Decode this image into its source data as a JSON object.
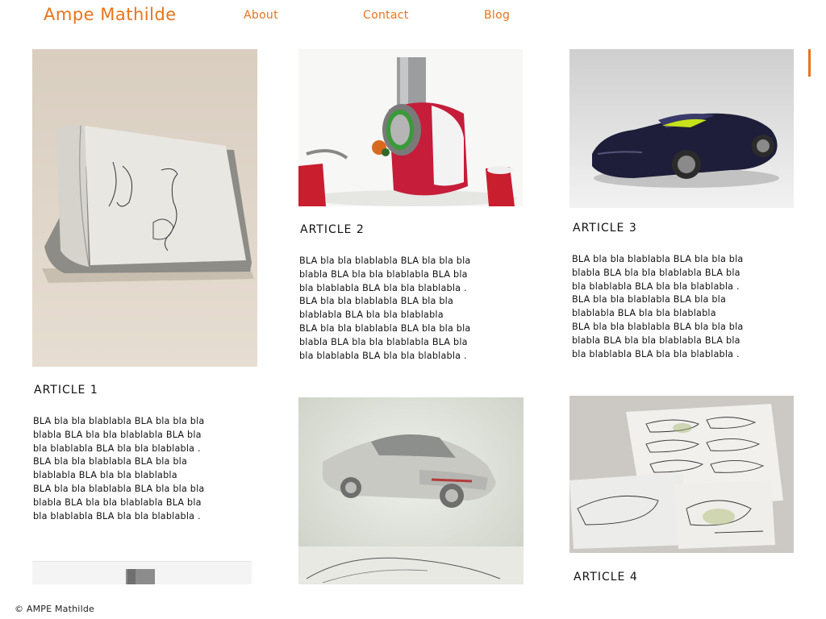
{
  "header": {
    "brand": "Ampe Mathilde",
    "nav": [
      {
        "label": "About"
      },
      {
        "label": "Contact"
      },
      {
        "label": "Blog"
      }
    ]
  },
  "articles": [
    {
      "title": "ARTICLE 1",
      "body": "BLA bla bla blablabla BLA bla bla bla\nblabla BLA bla bla blablabla BLA bla\nbla blablabla BLA bla bla blablabla .\nBLA bla bla blablabla BLA bla bla\nblablabla BLA bla bla blablabla\nBLA bla bla blablabla BLA bla bla bla\nblabla BLA bla bla blablabla BLA bla\nbla blablabla BLA bla bla blablabla ."
    },
    {
      "title": "ARTICLE 2",
      "body": "BLA bla bla blablabla BLA bla bla bla\nblabla BLA bla bla blablabla BLA bla\nbla blablabla BLA bla bla blablabla .\nBLA bla bla blablabla BLA bla bla\nblablabla BLA bla bla blablabla\nBLA bla bla blablabla BLA bla bla bla\nblabla BLA bla bla blablabla BLA bla\nbla blablabla BLA bla bla blablabla ."
    },
    {
      "title": "ARTICLE 3",
      "body": "BLA bla bla blablabla BLA bla bla bla\nblabla BLA bla bla blablabla BLA bla\nbla blablabla BLA bla bla blablabla .\nBLA bla bla blablabla BLA bla bla\nblablabla BLA bla bla blablabla\nBLA bla bla blablabla BLA bla bla bla\nblabla BLA bla bla blablabla BLA bla\nbla blablabla BLA bla bla blablabla ."
    },
    {
      "title": "ARTICLE 4"
    }
  ],
  "footer": {
    "copyright": "© AMPE Mathilde"
  },
  "colors": {
    "accent": "#e8731a",
    "text": "#111111",
    "background": "#ffffff"
  }
}
